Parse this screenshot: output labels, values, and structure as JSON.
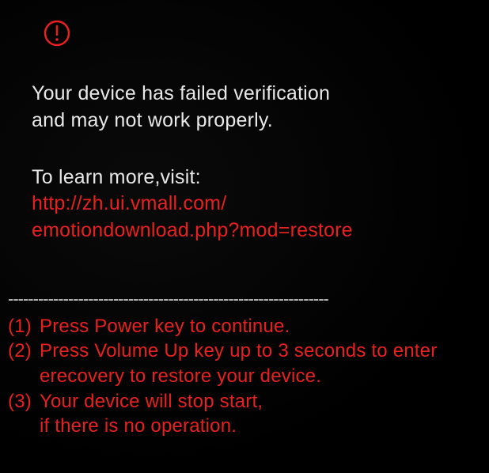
{
  "colors": {
    "text_white": "#e8e8e8",
    "text_red": "#e82020",
    "background": "#000000"
  },
  "alert_icon": "warning-circle-icon",
  "main_message_line1": "Your device has failed verification",
  "main_message_line2": "and may not work properly.",
  "learn_more_label": "To learn more,visit:",
  "url_line1": "http://zh.ui.vmall.com/",
  "url_line2": "emotiondownload.php?mod=restore",
  "divider": "----------------------------------------------------------------",
  "instructions": [
    {
      "num": "(1)",
      "text": "Press Power key to continue."
    },
    {
      "num": "(2)",
      "text": "Press Volume Up key up to 3 seconds to enter erecovery to restore your device."
    },
    {
      "num": "(3)",
      "text": "Your device will stop start,\nif there is no operation."
    }
  ]
}
